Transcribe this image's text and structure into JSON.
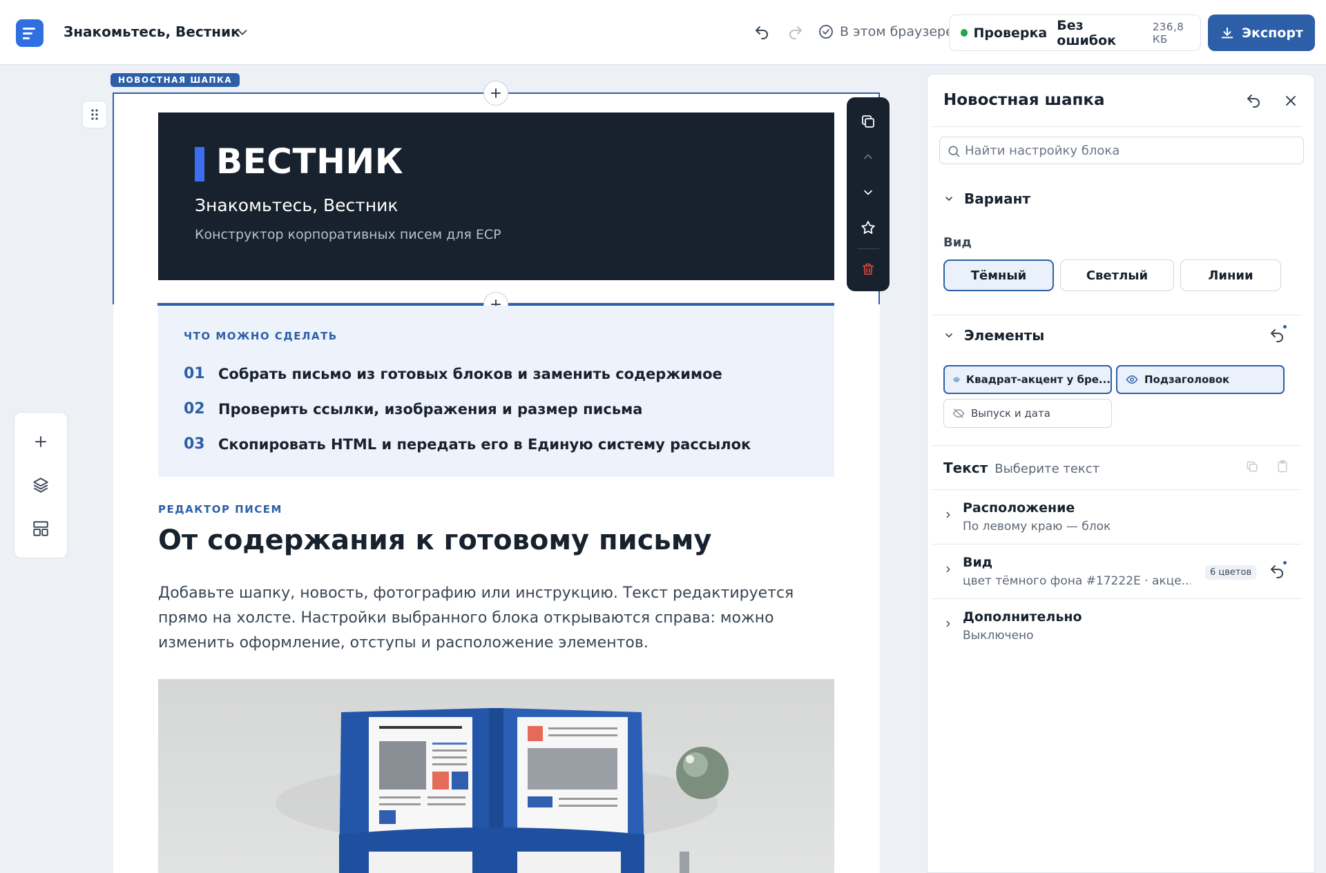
{
  "header": {
    "doc_title": "Знакомьтесь, Вестник",
    "browser_status": "В этом браузере",
    "check_label": "Проверка",
    "check_status": "Без ошибок",
    "size": "236,8 КБ",
    "export_label": "Экспорт"
  },
  "canvas": {
    "block_tag": "НОВОСТНАЯ ШАПКА",
    "hero": {
      "brand": "ВЕСТНИК",
      "subtitle": "Знакомьтесь, Вестник",
      "description": "Конструктор корпоративных писем для ЕСР"
    },
    "steps": {
      "kicker": "ЧТО МОЖНО СДЕЛАТЬ",
      "items": [
        {
          "num": "01",
          "text": "Собрать письмо из готовых блоков и заменить содержимое"
        },
        {
          "num": "02",
          "text": "Проверить ссылки, изображения и размер письма"
        },
        {
          "num": "03",
          "text": "Скопировать HTML и передать его в Единую систему рассылок"
        }
      ]
    },
    "article": {
      "kicker": "РЕДАКТОР ПИСЕМ",
      "title": "От содержания к готовому письму",
      "body": "Добавьте шапку, новость, фотографию или инструкцию. Текст редактируется прямо на холсте. Настройки выбранного блока открываются справа: можно изменить оформление, отступы и расположение элементов."
    }
  },
  "panel": {
    "title": "Новостная шапка",
    "search_placeholder": "Найти настройку блока",
    "variant": {
      "title": "Вариант",
      "field_label": "Вид",
      "options": [
        "Тёмный",
        "Светлый",
        "Линии"
      ],
      "selected": "Тёмный"
    },
    "elements": {
      "title": "Элементы",
      "chips": [
        {
          "label": "Квадрат-акцент у бре...",
          "visible": true
        },
        {
          "label": "Подзаголовок",
          "visible": true
        },
        {
          "label": "Выпуск и дата",
          "visible": false
        }
      ]
    },
    "text": {
      "label": "Текст",
      "hint": "Выберите текст"
    },
    "layout": {
      "title": "Расположение",
      "value": "По левому краю — блок"
    },
    "view": {
      "title": "Вид",
      "value": "цвет тёмного фона #17222E · акце...",
      "badge": "6 цветов"
    },
    "extra": {
      "title": "Дополнительно",
      "value": "Выключено"
    }
  },
  "colors": {
    "accent": "#2c5fa8",
    "dark_bg": "#17222E",
    "hero_accent": "#3d6ef0",
    "ok": "#1fa84f",
    "danger": "#e0463c"
  }
}
